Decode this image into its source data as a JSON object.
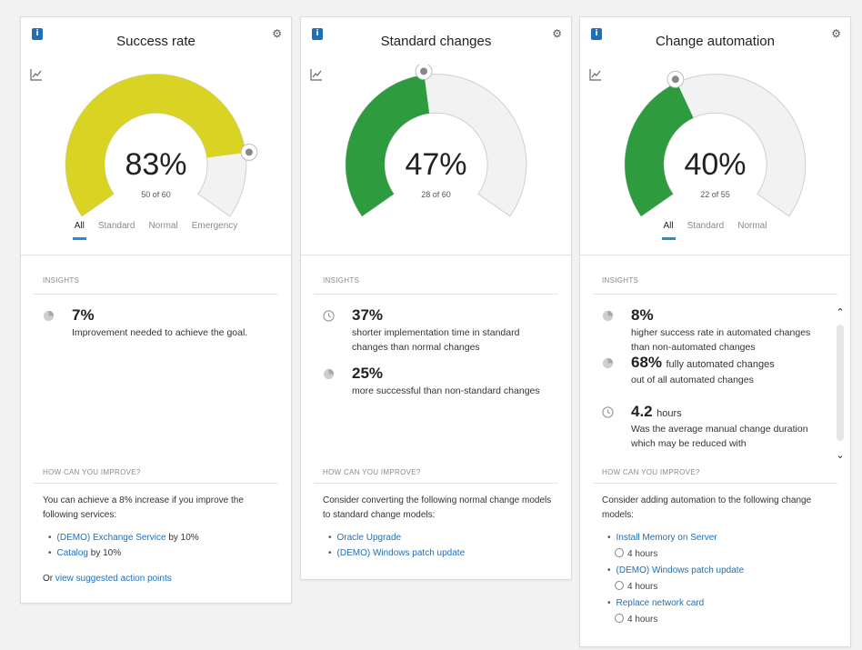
{
  "cards": [
    {
      "title": "Success rate",
      "percent": "83%",
      "sub": "50 of 60",
      "tabs": [
        "All",
        "Standard",
        "Normal",
        "Emergency"
      ],
      "active_tab": 0,
      "gauge_value": 0.83,
      "gauge_color": "#d9d323",
      "insights_label": "INSIGHTS",
      "insights": [
        {
          "icon": "pie-chart-icon",
          "value": "7%",
          "text": "Improvement needed to achieve the goal."
        }
      ],
      "improve_label": "HOW CAN YOU IMPROVE?",
      "improve_text": "You can achieve a 8% increase if you improve the following services:",
      "improve_items": [
        {
          "link": "(DEMO) Exchange Service",
          "suffix": " by 10%"
        },
        {
          "link": "Catalog",
          "suffix": " by 10%"
        }
      ],
      "footer_prefix": "Or ",
      "footer_link": "view suggested action points"
    },
    {
      "title": "Standard changes",
      "percent": "47%",
      "sub": "28 of 60",
      "gauge_value": 0.47,
      "gauge_color": "#2e9b3f",
      "insights_label": "INSIGHTS",
      "insights": [
        {
          "icon": "clock-icon",
          "value": "37%",
          "text": "shorter implementation time in standard changes than normal changes"
        },
        {
          "icon": "pie-chart-icon",
          "value": "25%",
          "text": "more successful than non-standard changes"
        }
      ],
      "improve_label": "HOW CAN YOU IMPROVE?",
      "improve_text": "Consider converting the following normal change models to standard change models:",
      "improve_items": [
        {
          "link": "Oracle Upgrade"
        },
        {
          "link": "(DEMO) Windows patch update"
        }
      ]
    },
    {
      "title": "Change automation",
      "percent": "40%",
      "sub": "22 of 55",
      "tabs": [
        "All",
        "Standard",
        "Normal"
      ],
      "active_tab": 0,
      "gauge_value": 0.4,
      "gauge_color": "#2e9b3f",
      "insights_label": "INSIGHTS",
      "insights": [
        {
          "icon": "pie-chart-icon",
          "value": "8%",
          "text": "higher success rate in automated changes than non-automated changes"
        },
        {
          "icon": "pie-chart-icon",
          "value": "68%",
          "inline": "fully automated changes",
          "text": "out of all automated changes"
        },
        {
          "icon": "clock-icon",
          "value": "4.2",
          "unit": "hours",
          "text": "Was the average manual change duration which may be reduced with"
        }
      ],
      "improve_label": "HOW CAN YOU IMPROVE?",
      "improve_text": "Consider adding automation to the following change models:",
      "improve_items": [
        {
          "link": "Install Memory on Server",
          "duration": "4 hours"
        },
        {
          "link": "(DEMO) Windows patch update",
          "duration": "4 hours"
        },
        {
          "link": "Replace network card",
          "duration": "4 hours"
        }
      ]
    }
  ],
  "colors": {
    "track": "#f2f2f2",
    "track_border": "#cfcfcf",
    "link": "#1f6fb8",
    "tab_indicator": "#1f8fd6"
  },
  "icons": {
    "info": "i",
    "gear": "⚙",
    "scroll_up": "⌃",
    "scroll_down": "⌄"
  }
}
